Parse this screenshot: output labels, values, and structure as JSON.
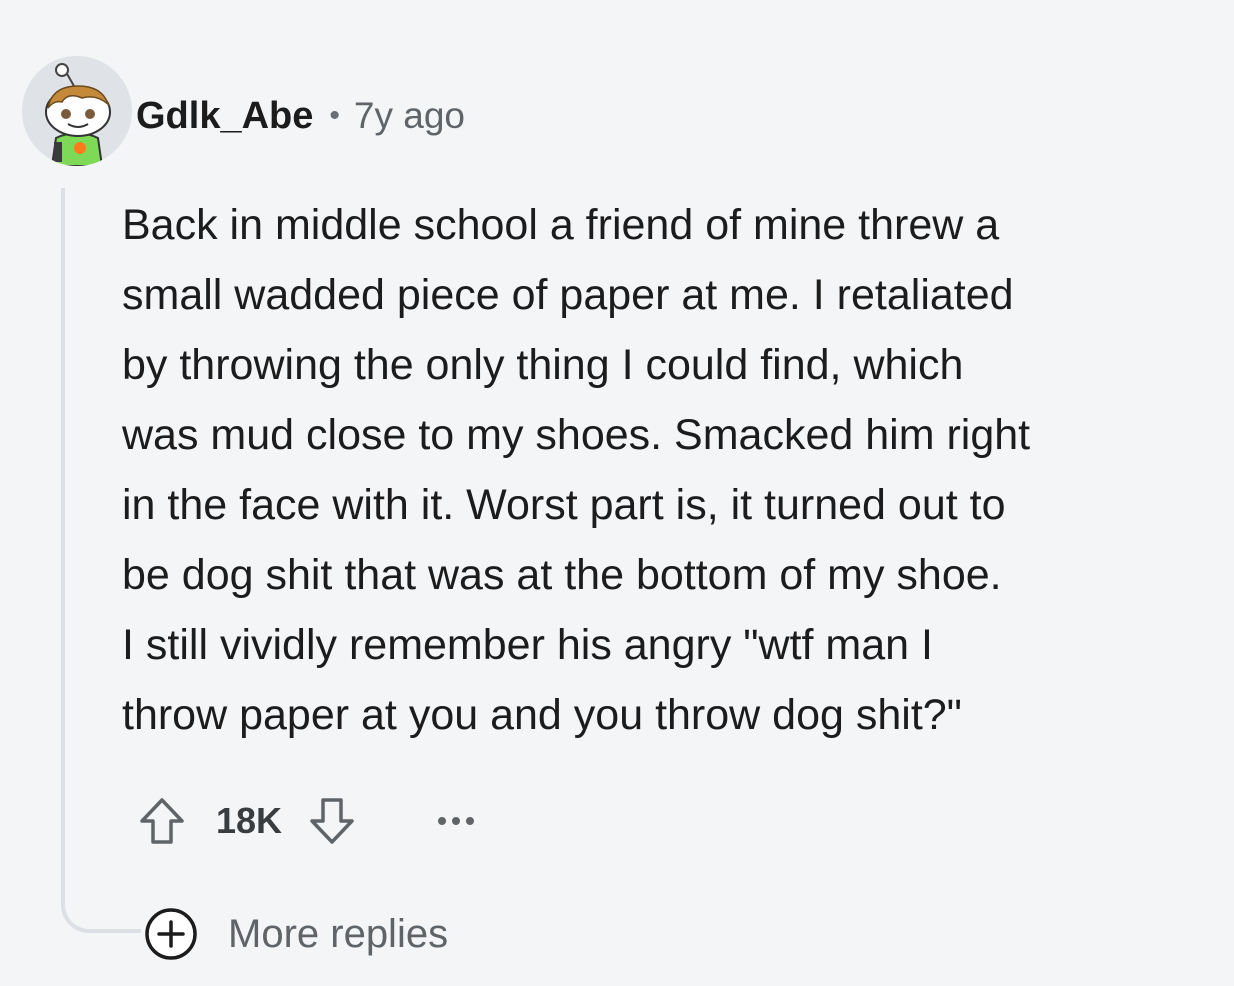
{
  "comment": {
    "author": "Gdlk_Abe",
    "separator": "•",
    "timestamp": "7y ago",
    "avatar_icon": "snoo-avatar-icon",
    "body_lines": [
      "Back in middle school a friend of mine threw a",
      "small wadded piece of paper at me. I retaliated",
      "by throwing the only thing I could find, which",
      "was mud close to my shoes. Smacked him right",
      "in the face with it. Worst part is, it turned out to",
      "be dog shit that was at the bottom of my shoe.",
      "I still vividly remember his angry \"wtf man I",
      "throw paper at you and you throw dog shit?\""
    ],
    "score": "18K"
  },
  "actions": {
    "upvote_icon": "upvote-arrow-icon",
    "downvote_icon": "downvote-arrow-icon",
    "more_icon": "ellipsis-icon"
  },
  "replies": {
    "icon": "plus-circle-icon",
    "label": "More replies"
  },
  "colors": {
    "background": "#f4f5f7",
    "text": "#1c1c1c",
    "muted": "#5f6468",
    "thread_line": "#dcdfe3"
  }
}
